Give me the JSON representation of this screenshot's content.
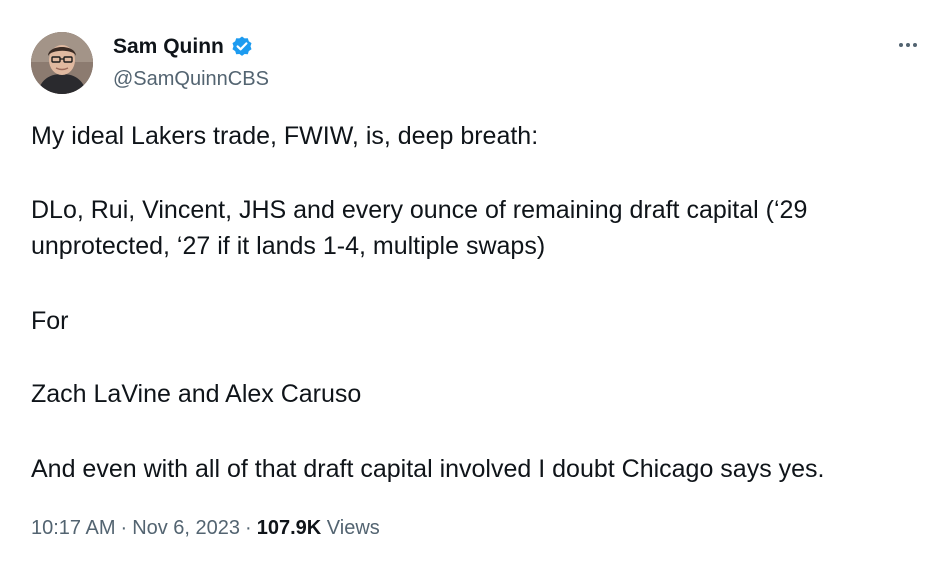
{
  "author": {
    "display_name": "Sam Quinn",
    "handle": "@SamQuinnCBS",
    "verified": true,
    "verified_color": "#1d9bf0"
  },
  "tweet": {
    "lines": [
      "My ideal Lakers trade, FWIW, is, deep breath:",
      "DLo, Rui, Vincent, JHS and every ounce of remaining draft capital (‘29",
      "unprotected, ‘27 if it lands 1-4, multiple swaps)",
      "For",
      "Zach LaVine and Alex Caruso",
      "And even with all of that draft capital involved I doubt Chicago says yes."
    ]
  },
  "meta": {
    "time": "10:17 AM",
    "date": "Nov 6, 2023",
    "views_count": "107.9K",
    "views_label": "Views",
    "separator": "·"
  },
  "icons": {
    "more": "more-horizontal-icon",
    "verified": "verified-badge-icon"
  }
}
